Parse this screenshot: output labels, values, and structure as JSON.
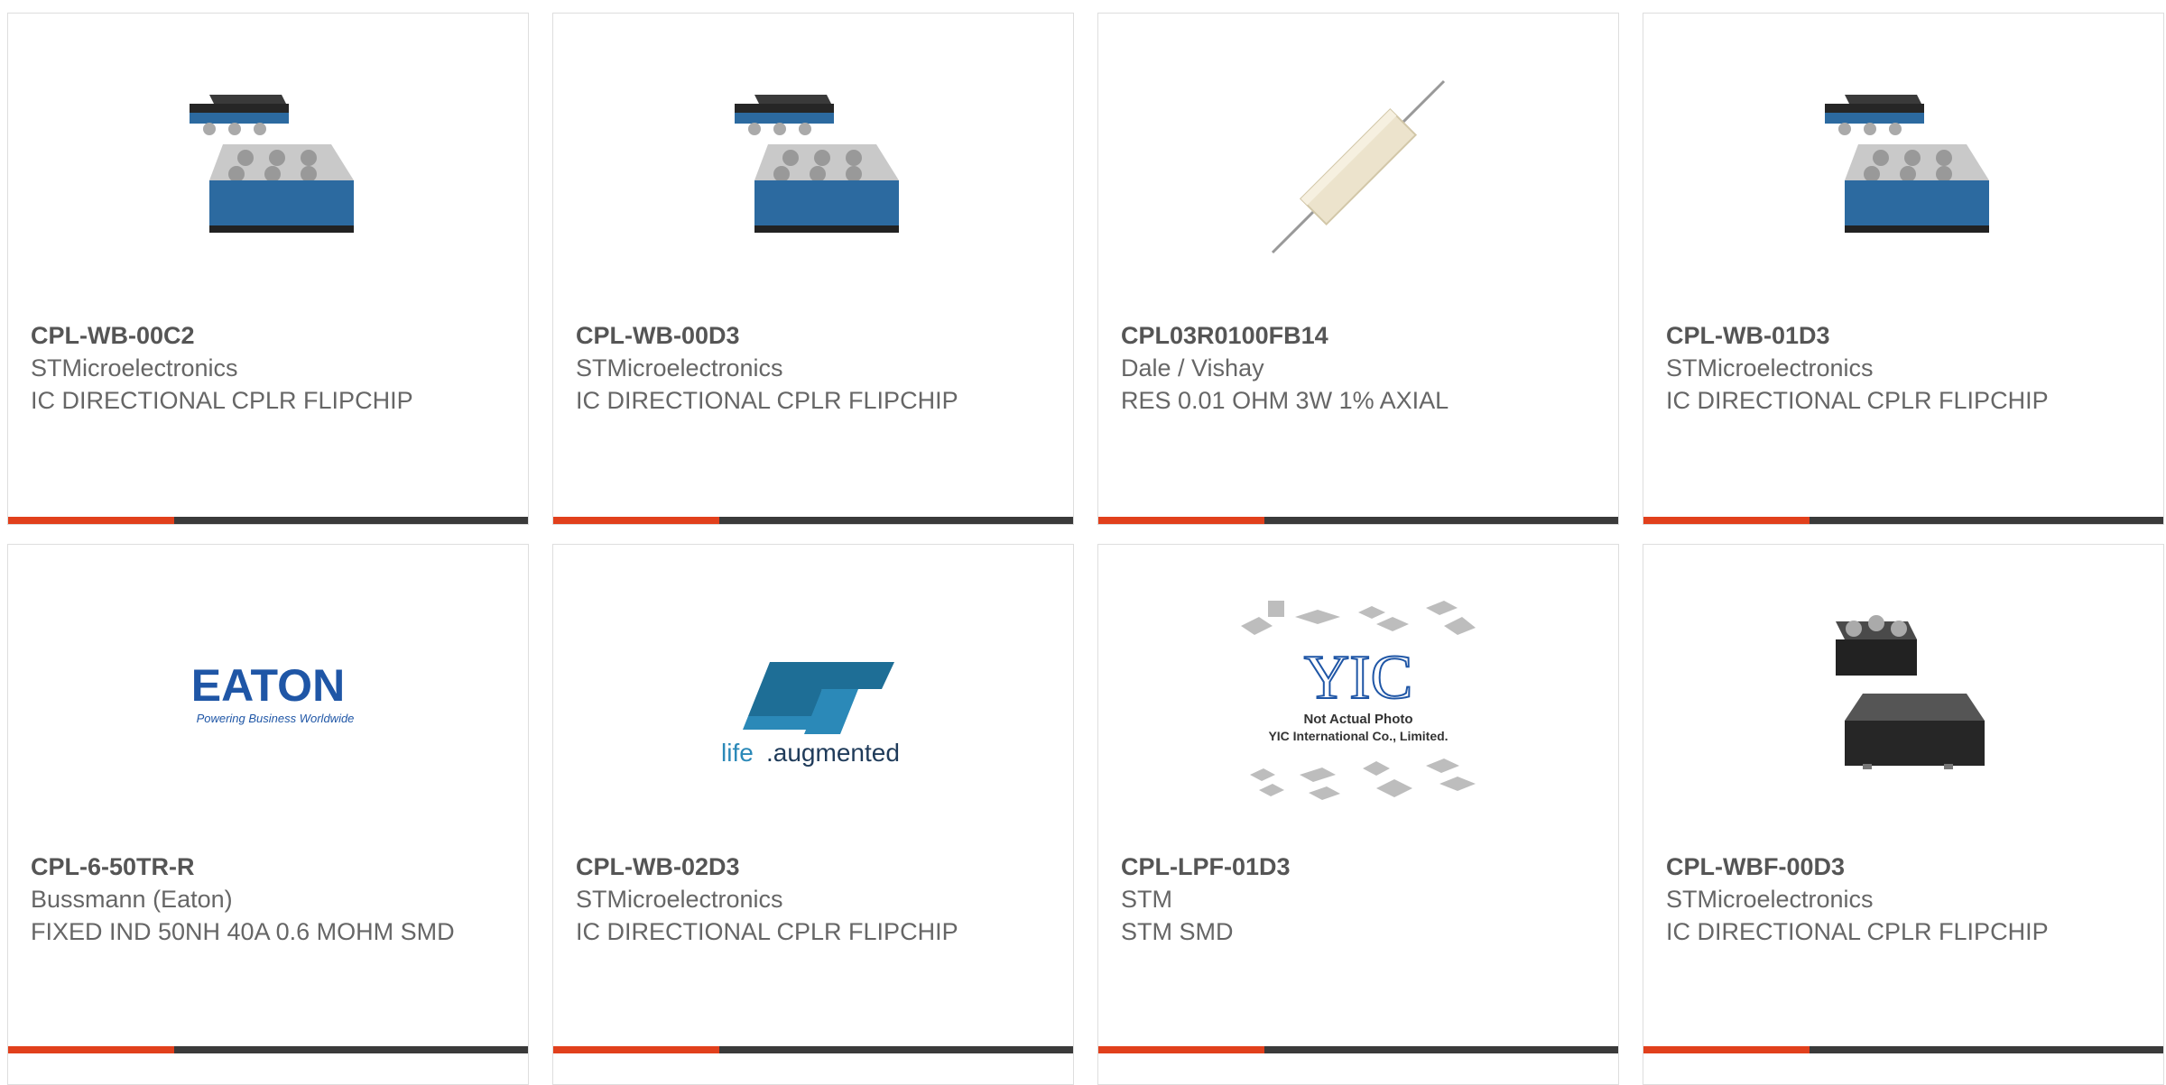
{
  "colors": {
    "accent": "#e1401c",
    "bar": "#3a3a3a",
    "border": "#dedede",
    "text": "#666666"
  },
  "products": [
    {
      "part": "CPL-WB-00C2",
      "manufacturer": "STMicroelectronics",
      "description": "IC DIRECTIONAL CPLR FLIPCHIP",
      "image": "flipchip-package"
    },
    {
      "part": "CPL-WB-00D3",
      "manufacturer": "STMicroelectronics",
      "description": "IC DIRECTIONAL CPLR FLIPCHIP",
      "image": "flipchip-package"
    },
    {
      "part": "CPL03R0100FB14",
      "manufacturer": "Dale / Vishay",
      "description": "RES 0.01 OHM 3W 1% AXIAL",
      "image": "axial-resistor"
    },
    {
      "part": "CPL-WB-01D3",
      "manufacturer": "STMicroelectronics",
      "description": "IC DIRECTIONAL CPLR FLIPCHIP",
      "image": "flipchip-package"
    },
    {
      "part": "CPL-6-50TR-R",
      "manufacturer": "Bussmann (Eaton)",
      "description": "FIXED IND 50NH 40A 0.6 MOHM SMD",
      "image": "eaton-logo"
    },
    {
      "part": "CPL-WB-02D3",
      "manufacturer": "STMicroelectronics",
      "description": "IC DIRECTIONAL CPLR FLIPCHIP",
      "image": "st-logo"
    },
    {
      "part": "CPL-LPF-01D3",
      "manufacturer": "STM",
      "description": "STM SMD",
      "image": "yic-placeholder"
    },
    {
      "part": "CPL-WBF-00D3",
      "manufacturer": "STMicroelectronics",
      "description": "IC DIRECTIONAL CPLR FLIPCHIP",
      "image": "black-package"
    }
  ],
  "logos": {
    "eaton_wordmark": "EATON",
    "eaton_tagline": "Powering Business Worldwide",
    "st_tagline_life": "life",
    "st_tagline_augmented": ".augmented",
    "yic_mark": "YIC",
    "yic_note_1": "Not Actual Photo",
    "yic_note_2": "YIC International Co., Limited."
  }
}
